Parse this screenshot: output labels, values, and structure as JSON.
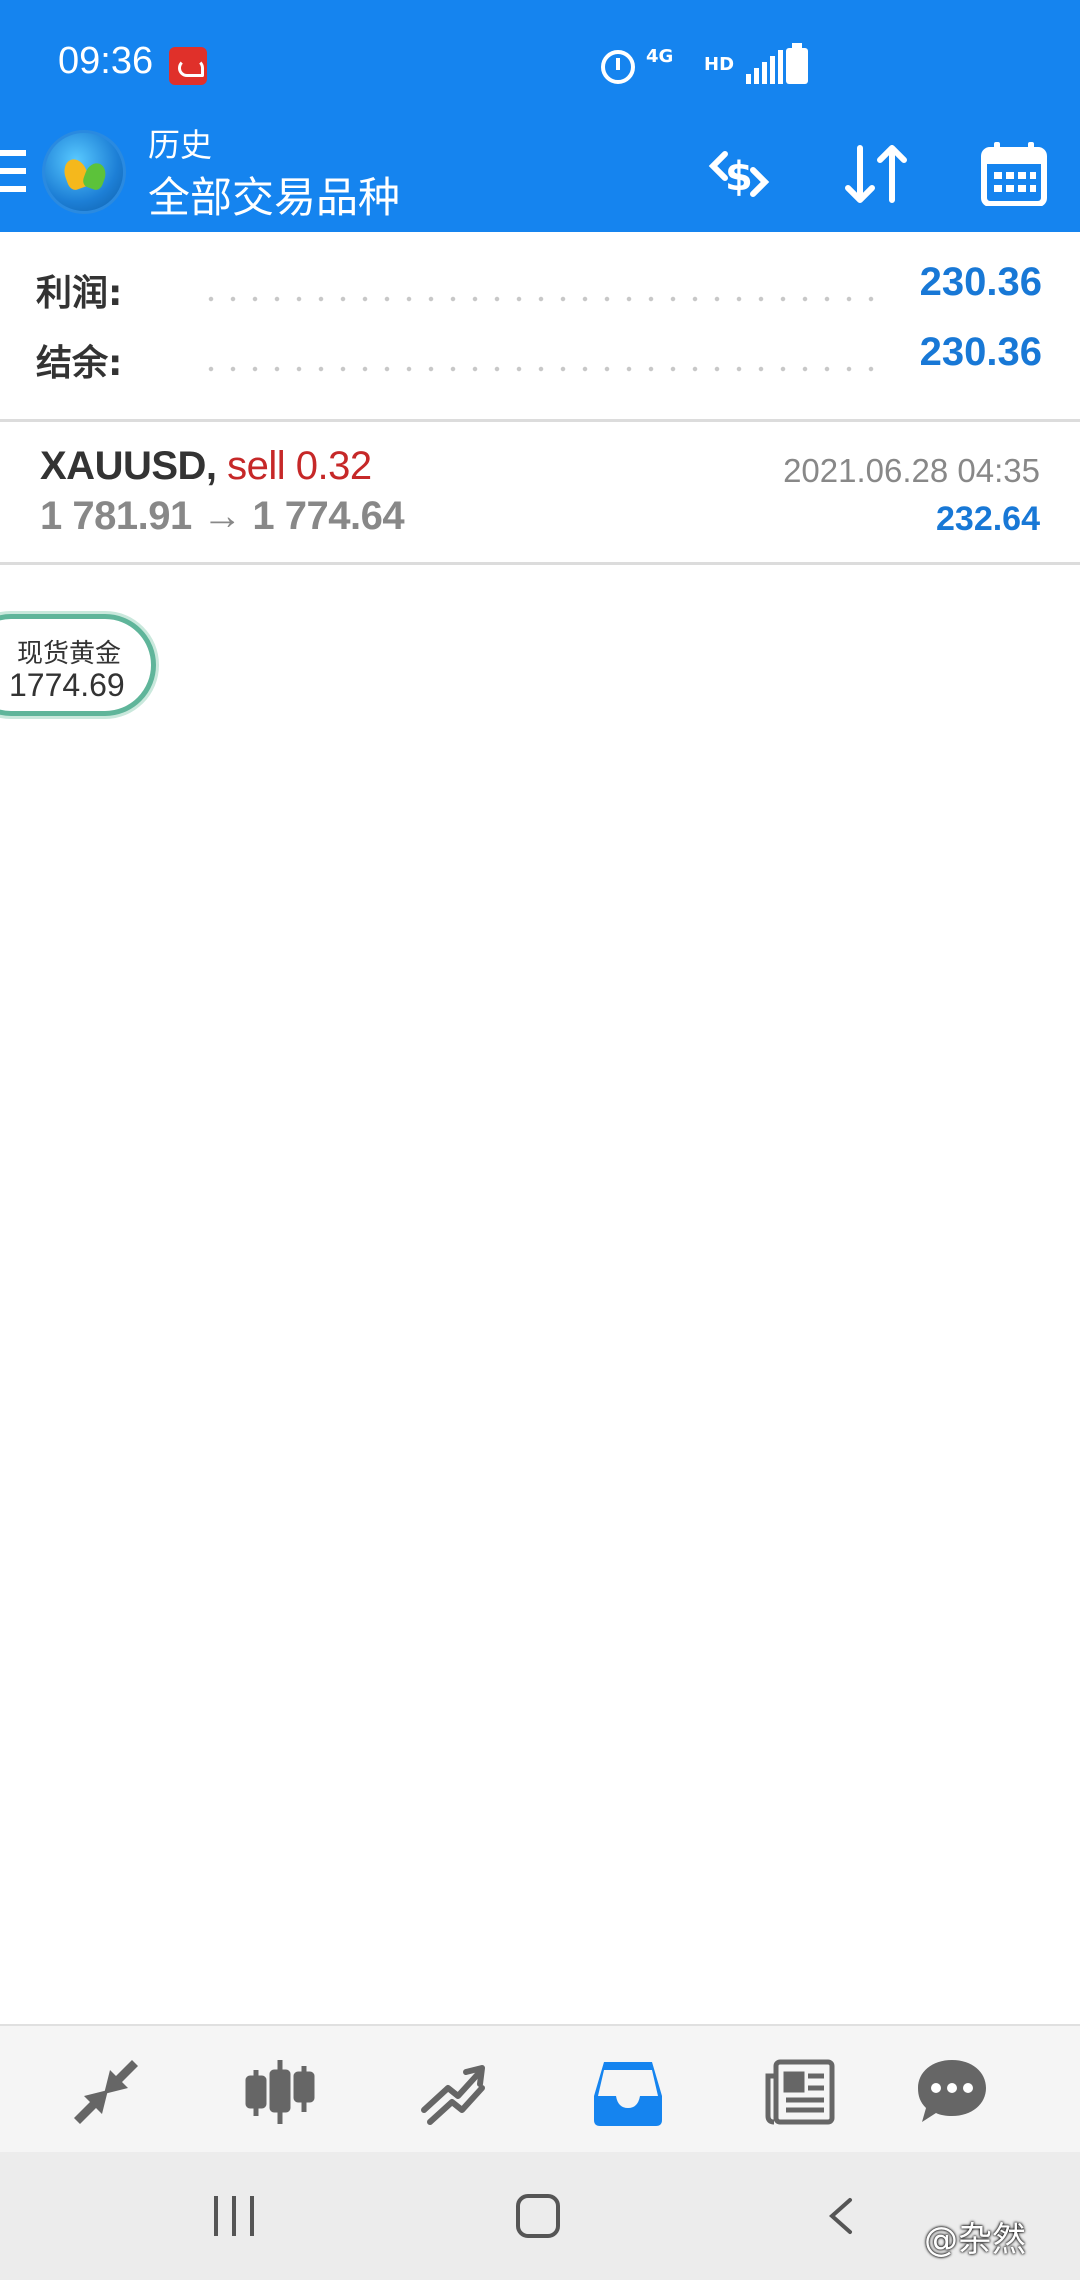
{
  "status_bar": {
    "time": "09:36",
    "network": "4G",
    "hd": "HD",
    "icons": [
      "app-notification-icon",
      "alarm-icon",
      "signal-icon",
      "battery-icon"
    ]
  },
  "app_bar": {
    "subtitle": "历史",
    "title": "全部交易品种",
    "icons": [
      "menu-icon",
      "app-logo",
      "currency-exchange-icon",
      "sort-icon",
      "calendar-icon"
    ]
  },
  "summary": {
    "profit_label": "利润:",
    "profit_value": "230.36",
    "balance_label": "结余:",
    "balance_value": "230.36"
  },
  "trades": [
    {
      "symbol": "XAUUSD,",
      "side": "sell 0.32",
      "prices": "1 781.91 → 1 774.64",
      "time": "2021.06.28 04:35",
      "profit": "232.64"
    }
  ],
  "bubble": {
    "name": "现货黄金",
    "price": "1774.69"
  },
  "bottom_nav": {
    "items": [
      "quotes-icon",
      "chart-icon",
      "trade-icon",
      "history-icon",
      "news-icon",
      "chat-icon"
    ],
    "active": "history-icon"
  },
  "watermark": "@杂然",
  "colors": {
    "primary": "#1584ef",
    "value_blue": "#1878d6",
    "sell_red": "#c62828",
    "active_nav": "#1584ef",
    "inactive_nav": "#666666"
  }
}
